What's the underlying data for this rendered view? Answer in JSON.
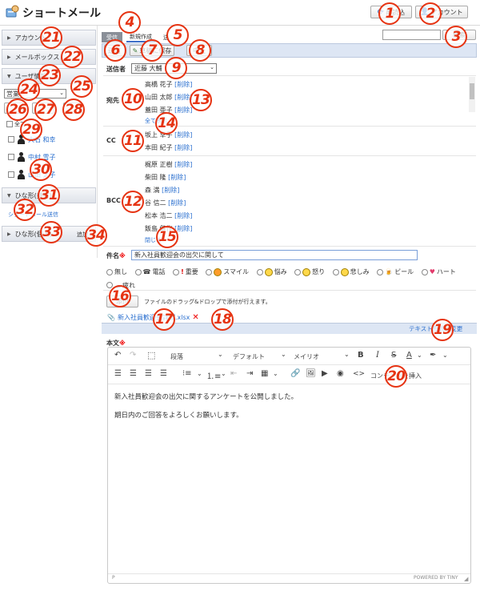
{
  "app": {
    "title": "ショートメール"
  },
  "header": {
    "reload_label": "再読込",
    "account_label": "アカウント"
  },
  "tabs": [
    {
      "label": "受信"
    },
    {
      "label": "新規作成"
    },
    {
      "label": "送"
    }
  ],
  "search": {
    "button_label": "検索",
    "value": ""
  },
  "toolbar": {
    "send_label": "送信",
    "save_label": "草稿に保存",
    "cancel_label": "中止"
  },
  "sender": {
    "label": "送信者",
    "value": "近藤 大輔"
  },
  "to": {
    "label": "宛先",
    "recipients": [
      {
        "name": "高橋 花子"
      },
      {
        "name": "山田 太郎"
      },
      {
        "name": "蓋田 亜子"
      }
    ],
    "show_all": "全て表示"
  },
  "cc": {
    "label": "CC",
    "recipients": [
      {
        "name": "坂上 幸子"
      },
      {
        "name": "本田 紀子"
      }
    ]
  },
  "bcc": {
    "label": "BCC",
    "recipients": [
      {
        "name": "梶原 正樹"
      },
      {
        "name": "柴田 隆"
      },
      {
        "name": "森 満"
      },
      {
        "name": "谷 信二"
      },
      {
        "name": "松本 浩二"
      },
      {
        "name": "飯島 健作"
      }
    ],
    "close": "閉じる"
  },
  "delete_label": "[削除]",
  "subject": {
    "label": "件名",
    "required": "※",
    "value": "新入社員歓迎会の出欠に関して"
  },
  "icons": {
    "options": [
      "無し",
      "電話",
      "重要",
      "スマイル",
      "悩み",
      "怒り",
      "悲しみ",
      "ビール",
      "ハート",
      "疲れ"
    ],
    "selected": "無し"
  },
  "attach": {
    "button_label": "添付",
    "hint": "ファイルのドラッグ&ドロップで添付が行えます。",
    "file": "新入社員歓迎会詳細.xlsx",
    "remove": "✕"
  },
  "text_switch": "テキスト形式に変更",
  "body": {
    "label": "本文",
    "required": "※",
    "paragraphs": [
      "新入社員歓迎会の出欠に関するアンケートを公開しました。",
      "期日内のご回答をよろしくお願いします。"
    ],
    "status_left": "P",
    "status_right": "POWERED BY TINY"
  },
  "editor_toolbar": {
    "block": "段落",
    "font": "デフォルト",
    "family": "メイリオ",
    "content_insert": "コンテンツを挿入"
  },
  "sidebar": {
    "account": "アカウント",
    "mailbox": "メールボックス",
    "users_label": "ユーザ情報",
    "select_value": "営業",
    "users": [
      {
        "name": "大石 和幸"
      },
      {
        "name": "中村 雪子"
      },
      {
        "name": "山田 太子"
      }
    ],
    "all_label": "全て",
    "template_label": "ひな形(共有)",
    "send_template": "ショートメール送信",
    "template_personal": "ひな形(個人)",
    "add": "追加"
  },
  "badges": [
    "1",
    "2",
    "3",
    "4",
    "5",
    "6",
    "7",
    "8",
    "9",
    "10",
    "11",
    "12",
    "13",
    "14",
    "15",
    "16",
    "17",
    "18",
    "19",
    "20",
    "21",
    "22",
    "23",
    "24",
    "25",
    "26",
    "27",
    "28",
    "29",
    "30",
    "31",
    "32",
    "33",
    "34"
  ]
}
